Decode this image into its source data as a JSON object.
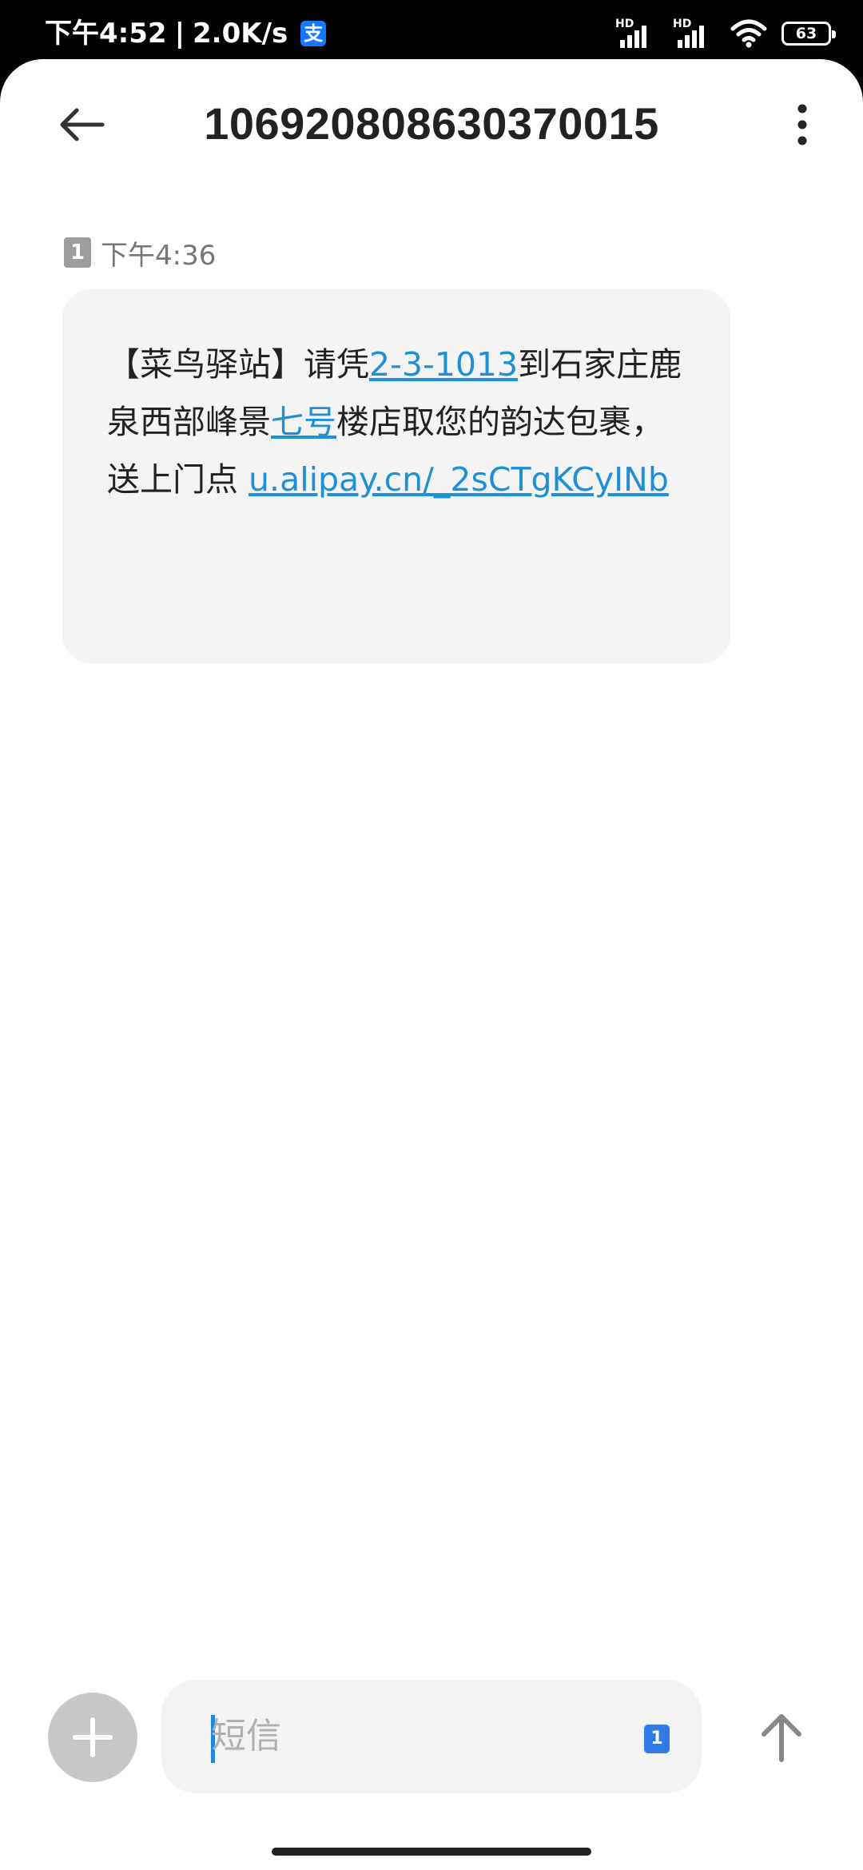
{
  "status_bar": {
    "time": "下午4:52",
    "network_speed": "2.0K/s",
    "app_badge": "支",
    "signal_1_label": "HD",
    "signal_2_label": "HD",
    "battery": "63",
    "icons": [
      "alipay-icon",
      "hd-signal-icon",
      "hd-signal-icon",
      "wifi-icon",
      "battery-icon"
    ]
  },
  "header": {
    "title": "1069208086303700​15",
    "back_icon": "back-arrow-icon",
    "more_icon": "more-vertical-icon"
  },
  "message": {
    "sim": "1",
    "time": "下午4:36",
    "text_parts": {
      "p1": "【菜鸟驿站】请凭",
      "link1": "2-3-1013",
      "p2": "到石家庄鹿泉西部峰景",
      "link2": "七号",
      "p3": "楼店取您的韵达包裹，送上门点 ",
      "link3": "u.alipay.cn/_2sCTgKCyINb"
    }
  },
  "composer": {
    "placeholder": "短信",
    "sim": "1",
    "add_icon": "plus-icon",
    "send_icon": "send-arrow-up-icon"
  },
  "colors": {
    "link": "#1e90d8",
    "bubble": "#f4f4f4",
    "sim_selector": "#2f7be8"
  }
}
